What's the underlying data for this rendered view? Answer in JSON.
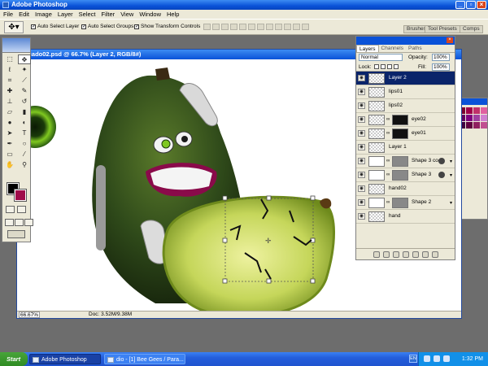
{
  "app": {
    "title": "Adobe Photoshop"
  },
  "menu": [
    "File",
    "Edit",
    "Image",
    "Layer",
    "Select",
    "Filter",
    "View",
    "Window",
    "Help"
  ],
  "options": {
    "auto_select_layer": "Auto Select Layer",
    "auto_select_groups": "Auto Select Groups",
    "show_transform_controls": "Show Transform Controls",
    "palette_tabs": [
      "Brushes",
      "Tool Presets",
      "Comps"
    ]
  },
  "document": {
    "title": "vocado02.psd @ 66.7% (Layer 2, RGB/8#)",
    "zoom": "66.67%",
    "doc_info": "Doc: 3.52M/9.38M"
  },
  "layers_panel": {
    "tabs": [
      "Layers",
      "Channels",
      "Paths"
    ],
    "blend_mode": "Normal",
    "opacity_label": "Opacity:",
    "opacity_value": "100%",
    "lock_label": "Lock:",
    "fill_label": "Fill:",
    "fill_value": "100%",
    "layers": [
      {
        "name": "Layer 2",
        "selected": true
      },
      {
        "name": "lips01"
      },
      {
        "name": "lips02"
      },
      {
        "name": "eye02",
        "mask": "black"
      },
      {
        "name": "eye01",
        "mask": "black"
      },
      {
        "name": "Layer 1"
      },
      {
        "name": "Shape 3 co...",
        "mask": "grey",
        "fx": true
      },
      {
        "name": "Shape 3",
        "mask": "grey",
        "fx": true
      },
      {
        "name": "hand02"
      },
      {
        "name": "Shape 2",
        "mask": "grey",
        "fx": true
      },
      {
        "name": "hand"
      }
    ]
  },
  "taskbar": {
    "start": "Start",
    "tasks": [
      "Adobe Photoshop",
      "dio - [1] Bee Gees / Para..."
    ],
    "lang": "EN",
    "clock": "1:32 PM"
  },
  "colors": {
    "avocado_skin": "#2f4a1a",
    "pear_flesh": "#c5d65a",
    "background_swatch": "#a00c4a",
    "selection_blue": "#0a246a"
  }
}
